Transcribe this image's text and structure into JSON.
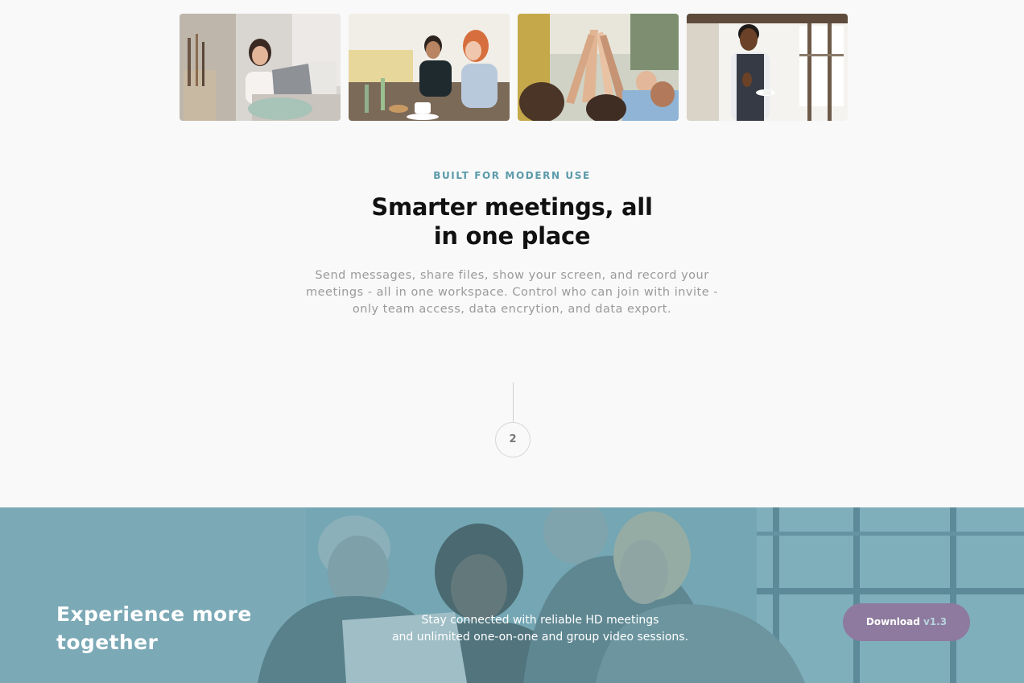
{
  "gallery": {
    "photos": [
      {
        "subject": "woman-working-on-laptop"
      },
      {
        "subject": "colleagues-meeting-at-table"
      },
      {
        "subject": "team-high-five"
      },
      {
        "subject": "man-thumbs-up-with-coffee"
      }
    ]
  },
  "feature": {
    "eyebrow": "BUILT FOR MODERN USE",
    "headline_line1": "Smarter meetings, all",
    "headline_line2": "in one place",
    "description_line1": "Send messages, share files, show your screen, and record your",
    "description_line2": "meetings - all in one workspace. Control who can join with invite -",
    "description_line3": "only team access, data encrytion, and data export."
  },
  "step": {
    "number": "2"
  },
  "banner": {
    "title_line1": "Experience more",
    "title_line2": "together",
    "text_line1": "Stay connected with reliable HD meetings",
    "text_line2": "and unlimited one-on-one and group video sessions.",
    "button_label": "Download",
    "button_version": "v1.3"
  },
  "colors": {
    "accent_teal": "#5b9aaa",
    "banner_overlay": "#6fa2b0",
    "button_purple": "#8e7a9e"
  }
}
